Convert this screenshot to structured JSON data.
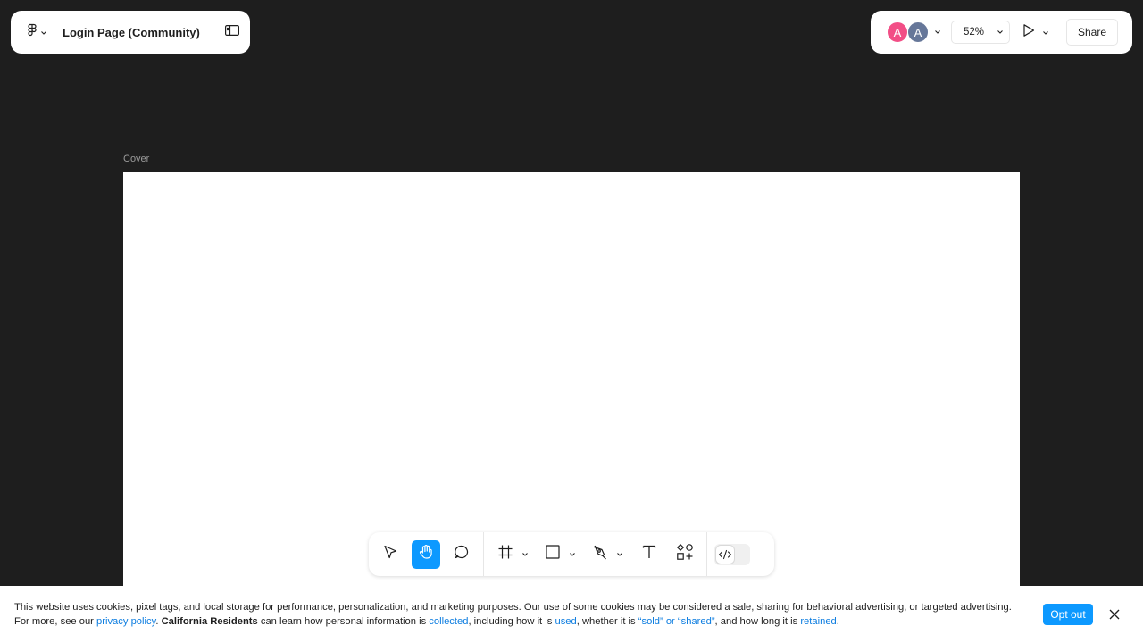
{
  "header": {
    "file_title": "Login Page (Community)",
    "icons": {
      "menu": "figma-logo-icon",
      "sidebar": "sidebar-toggle-icon"
    }
  },
  "right_panel": {
    "avatars": [
      {
        "initial": "A",
        "color": "#f24e86"
      },
      {
        "initial": "A",
        "color": "#667799"
      }
    ],
    "zoom": "52%",
    "share_label": "Share",
    "icons": {
      "present": "play-icon",
      "chevron": "chevron-down-icon"
    }
  },
  "canvas": {
    "frame_label": "Cover"
  },
  "toolbar": {
    "tools": [
      "move-tool-icon",
      "hand-tool-icon",
      "comment-icon",
      "frame-icon",
      "rectangle-icon",
      "pen-icon",
      "text-icon",
      "resources-icon",
      "dev-mode-icon"
    ],
    "active_tool": "hand-tool-icon",
    "accent": "#0d99ff"
  },
  "cookie_banner": {
    "t1": "This website uses cookies, pixel tags, and local storage for performance, personalization, and marketing purposes. Our use of some cookies may be considered a sale, sharing for behavioral advertising, or targeted advertising. For more, see our ",
    "link_privacy": "privacy policy",
    "t2": ". ",
    "bold_residents": "California Residents",
    "t3": " can learn how personal information is ",
    "link_collected": "collected",
    "t4": ", including how it is ",
    "link_used": "used",
    "t5": ", whether it is ",
    "link_sold": "“sold” or “shared”",
    "t6": ", and how long it is ",
    "link_retained": "retained",
    "t7": ".",
    "opt_out_label": "Opt out",
    "link_color": "#0d7de0"
  }
}
